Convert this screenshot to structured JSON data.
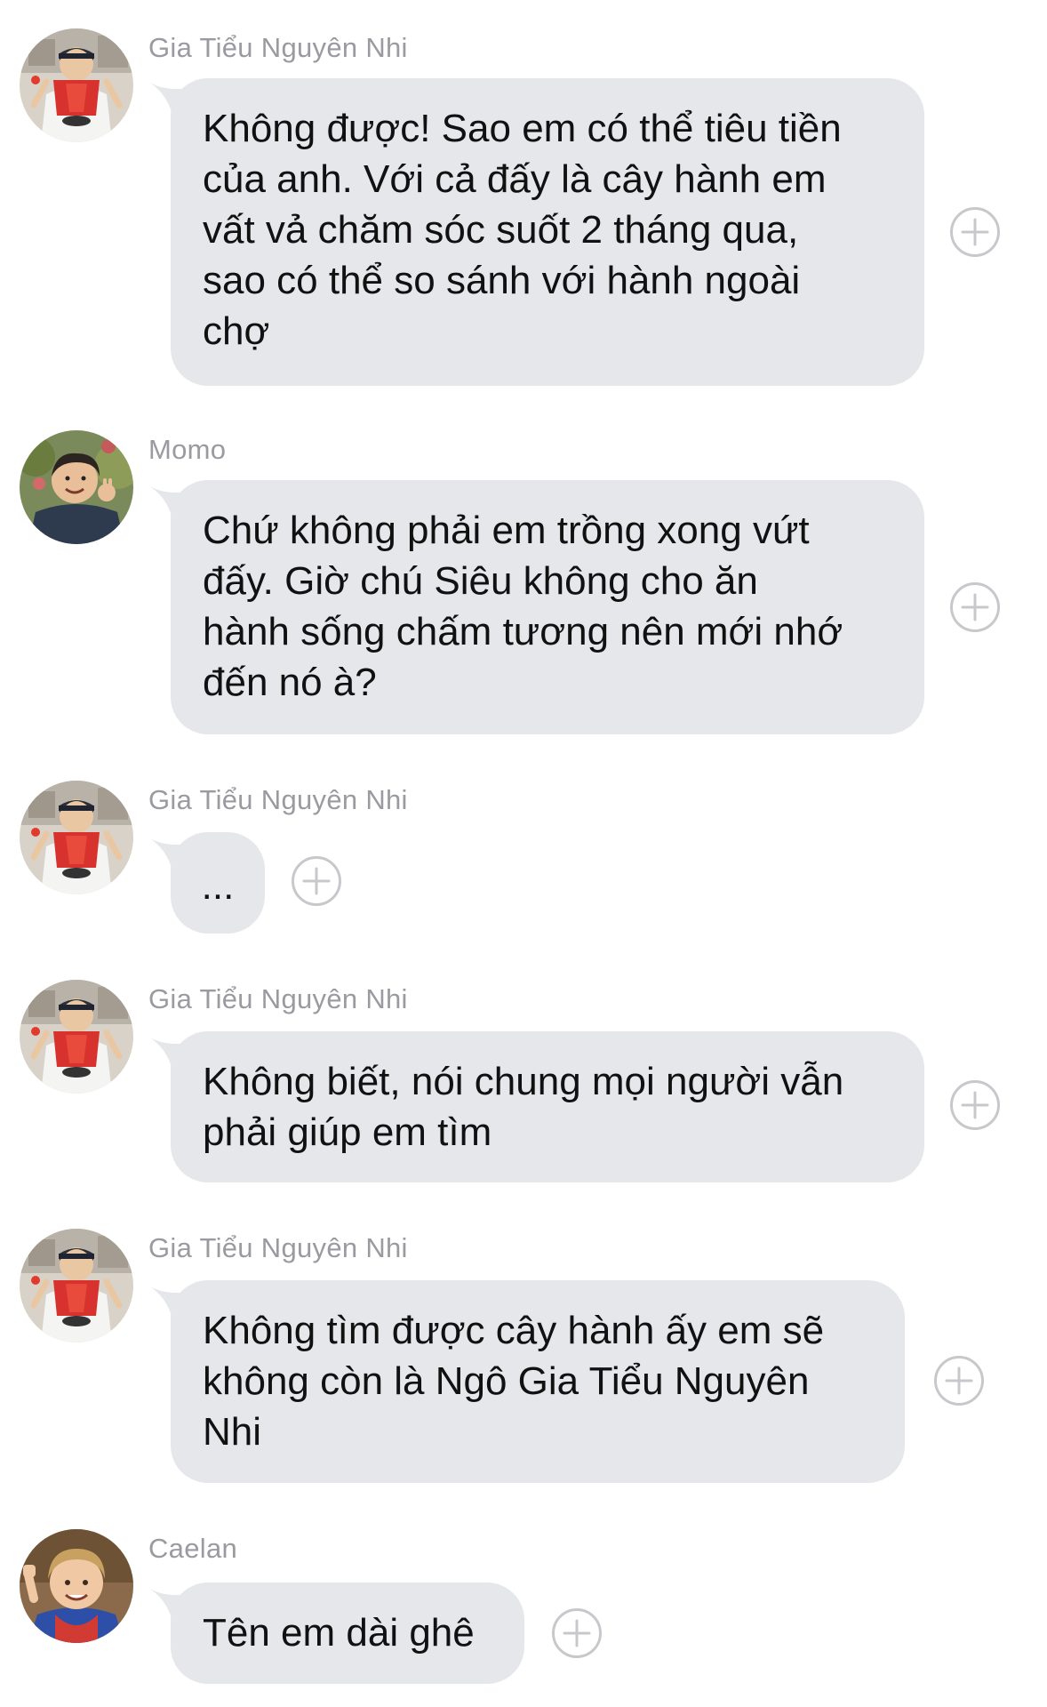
{
  "messages": [
    {
      "sender": "Gia Tiểu Nguyên Nhi",
      "avatar": "avatar-nguyen-nhi",
      "text": "Không được! Sao em có thể tiêu tiền\ncủa anh. Với cả đấy là cây hành em\nvất vả chăm sóc suốt 2 tháng qua,\nsao có thể so sánh với hành ngoài\nchợ"
    },
    {
      "sender": "Momo",
      "avatar": "avatar-momo",
      "text": "Chứ không phải em trồng xong vứt\nđấy. Giờ chú Siêu không cho ăn\nhành sống chấm tương nên mới nhớ\nđến nó à?"
    },
    {
      "sender": "Gia Tiểu Nguyên Nhi",
      "avatar": "avatar-nguyen-nhi",
      "text": "..."
    },
    {
      "sender": "Gia Tiểu Nguyên Nhi",
      "avatar": "avatar-nguyen-nhi",
      "text": "Không biết, nói chung mọi người vẫn\nphải giúp em tìm"
    },
    {
      "sender": "Gia Tiểu Nguyên Nhi",
      "avatar": "avatar-nguyen-nhi",
      "text": "Không tìm được cây hành ấy em sẽ\nkhông còn là Ngô Gia Tiểu Nguyên\nNhi"
    },
    {
      "sender": "Caelan",
      "avatar": "avatar-caelan",
      "text": "Tên em dài ghê"
    }
  ],
  "icons": {
    "reaction": "add-reaction-icon"
  },
  "colors": {
    "bubble": "#e6e7ea",
    "sender_name": "#9a9aa0",
    "message_text": "#111111",
    "reaction_icon": "#c8c8cc"
  }
}
